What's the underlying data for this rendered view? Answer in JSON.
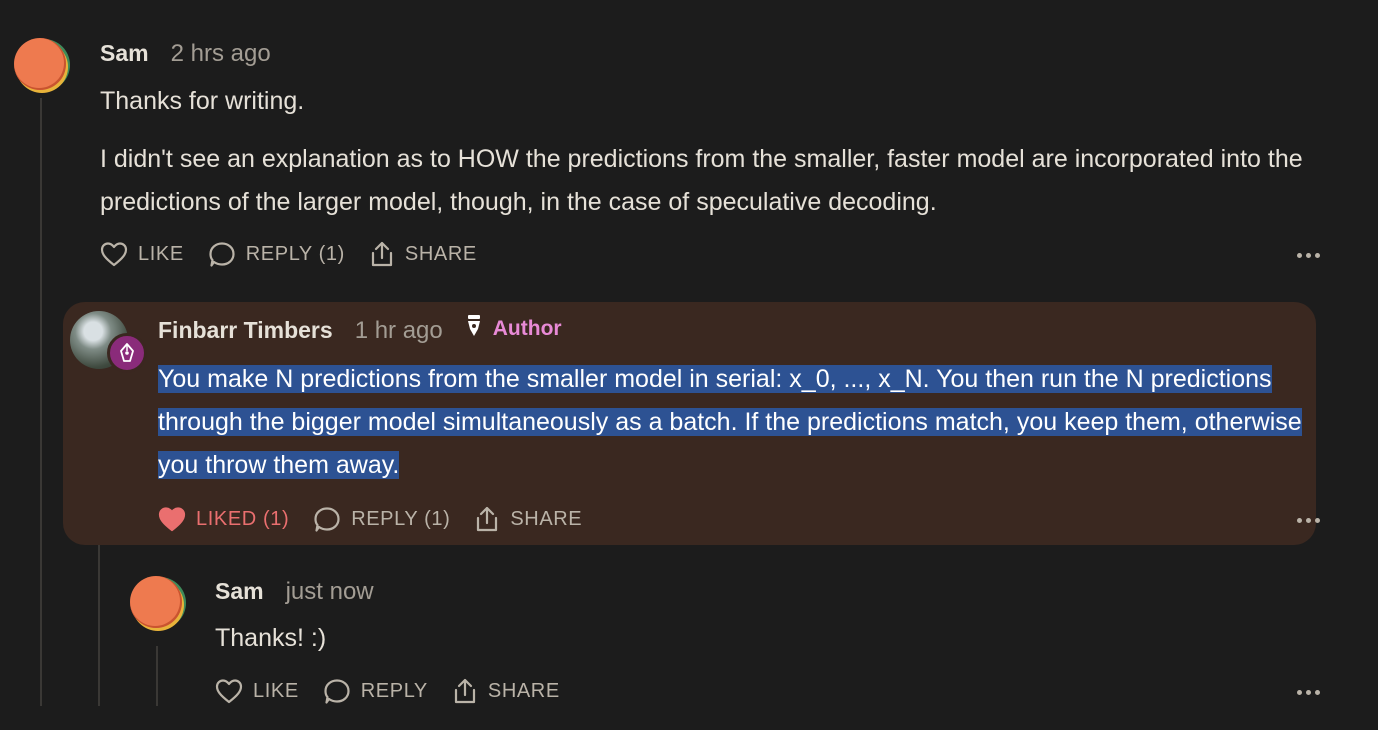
{
  "comments": [
    {
      "author": "Sam",
      "time": "2 hrs ago",
      "paragraphs": [
        "Thanks for writing.",
        "I didn't see an explanation as to HOW the predictions from the smaller, faster model are incorporated into the predictions of the larger model, though, in the case of speculative decoding."
      ],
      "actions": {
        "like": "LIKE",
        "reply": "REPLY (1)",
        "share": "SHARE"
      },
      "avatar_icon": "orange-avatar"
    },
    {
      "author": "Finbarr Timbers",
      "time": "1 hr ago",
      "badge": "Author",
      "badge_icon": "pen-nib-icon",
      "text": "You make N predictions from the smaller model in serial: x_0, ..., x_N. You then run the N predictions through the bigger model simultaneously as a batch. If the predictions match, you keep them, otherwise you throw them away.",
      "text_selected": true,
      "actions": {
        "like": "LIKED (1)",
        "reply": "REPLY (1)",
        "share": "SHARE"
      },
      "liked": true
    },
    {
      "author": "Sam",
      "time": "just now",
      "text": "Thanks! :)",
      "actions": {
        "like": "LIKE",
        "reply": "REPLY",
        "share": "SHARE"
      }
    }
  ],
  "colors": {
    "background": "#1c1c1c",
    "author_card": "#3a2820",
    "selection": "#2d5293",
    "author_badge": "#e88ad6",
    "liked": "#ea6f6f"
  }
}
